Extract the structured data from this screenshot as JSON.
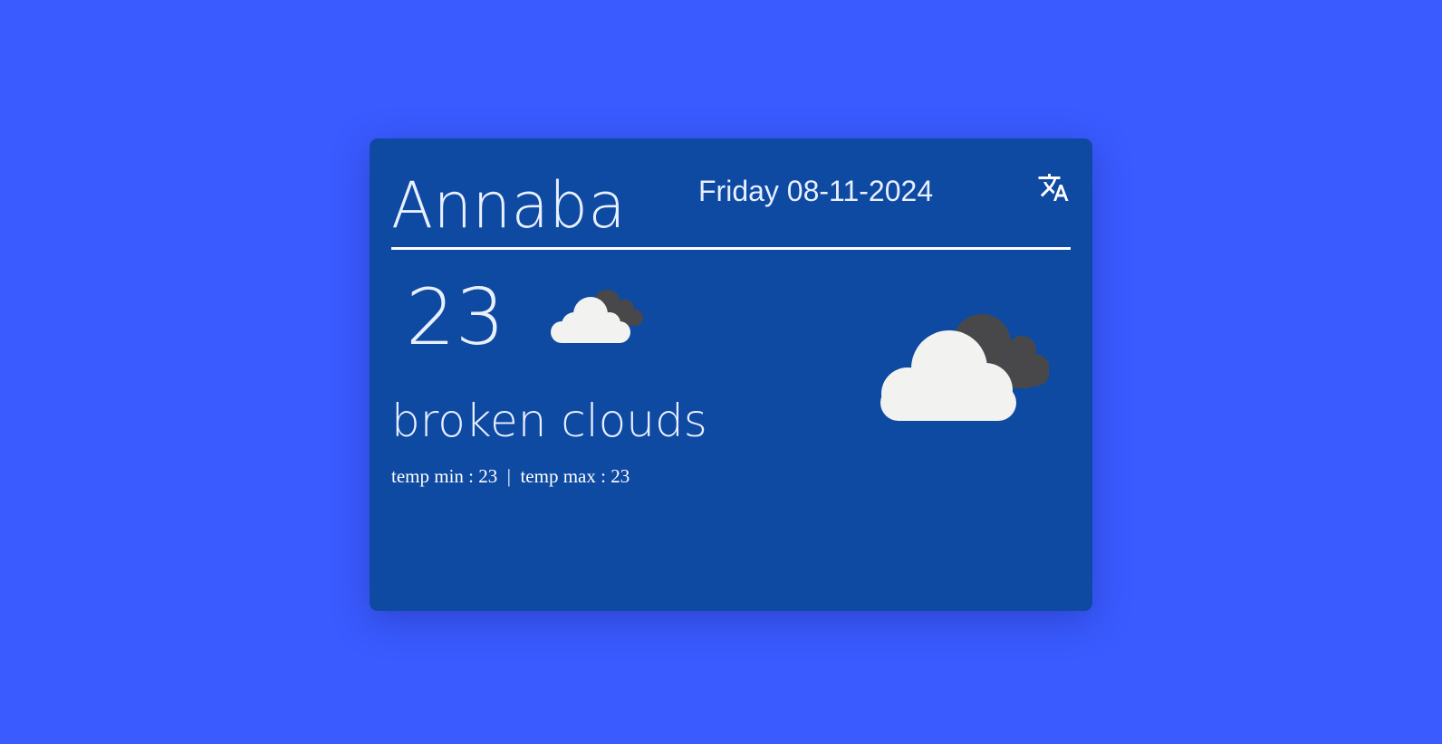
{
  "weather": {
    "city": "Annaba",
    "date": "Friday 08-11-2024",
    "temperature": "23",
    "description": "broken clouds",
    "temp_min_label": "temp min : ",
    "temp_min": "23",
    "separator": "  |  ",
    "temp_max_label": "temp max : ",
    "temp_max": "23",
    "condition_icon": "broken-clouds-icon",
    "language_icon": "translate-icon"
  },
  "colors": {
    "page_background": "#3a5bff",
    "card_background": "#0e49a2",
    "text": "#e9f0ff",
    "cloud_front": "#f2f2f0",
    "cloud_back": "#48484a"
  }
}
